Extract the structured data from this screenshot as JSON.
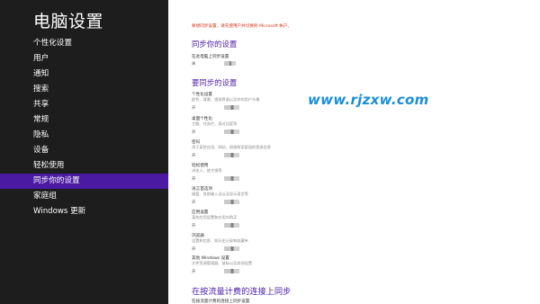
{
  "sidebar": {
    "title": "电脑设置",
    "items": [
      {
        "label": "个性化设置"
      },
      {
        "label": "用户"
      },
      {
        "label": "通知"
      },
      {
        "label": "搜索"
      },
      {
        "label": "共享"
      },
      {
        "label": "常规"
      },
      {
        "label": "隐私"
      },
      {
        "label": "设备"
      },
      {
        "label": "轻松使用"
      },
      {
        "label": "同步你的设置",
        "selected": true
      },
      {
        "label": "家庭组"
      },
      {
        "label": "Windows 更新"
      }
    ],
    "colors": {
      "background": "#1d1d1d",
      "selected": "#4a1aa3"
    }
  },
  "main": {
    "notice": "要想同步设置，请先使用户并切换到 Microsoft 帐户。",
    "sync_section": {
      "heading": "同步你的设置",
      "label": "在此电脑上同步设置",
      "state": "关"
    },
    "what_to_sync": {
      "heading": "要同步的设置",
      "settings": [
        {
          "title": "个性化设置",
          "description": "颜色、背景、锁屏界面以及你的用户头像",
          "state": "开"
        },
        {
          "title": "桌面个性化",
          "description": "主题、任务栏、高对比度等",
          "state": "开"
        },
        {
          "title": "密码",
          "description": "用于某些应用、网站、网络和家庭组的登录信息",
          "state": "开"
        },
        {
          "title": "轻松使用",
          "description": "讲述人、放大镜等",
          "state": "开"
        },
        {
          "title": "语言首选项",
          "description": "键盘、其他输入法以及显示语言等",
          "state": "开"
        },
        {
          "title": "应用设置",
          "description": "某些应用设置和应用内购买",
          "state": "开"
        },
        {
          "title": "浏览器",
          "description": "设置和信息，如历史记录和收藏夹",
          "state": "开"
        },
        {
          "title": "其他 Windows 设置",
          "description": "文件资源管理器、鼠标以及其他设置",
          "state": "开"
        }
      ]
    },
    "metered_section": {
      "heading": "在按流量计费的连接上同步",
      "label": "在按流量计费的连接上同步设置"
    }
  },
  "watermark": "www.rjzxw.com",
  "colors": {
    "accent": "#4b1ca6",
    "notice": "#d8361a",
    "watermark": "#1a8fd6"
  }
}
